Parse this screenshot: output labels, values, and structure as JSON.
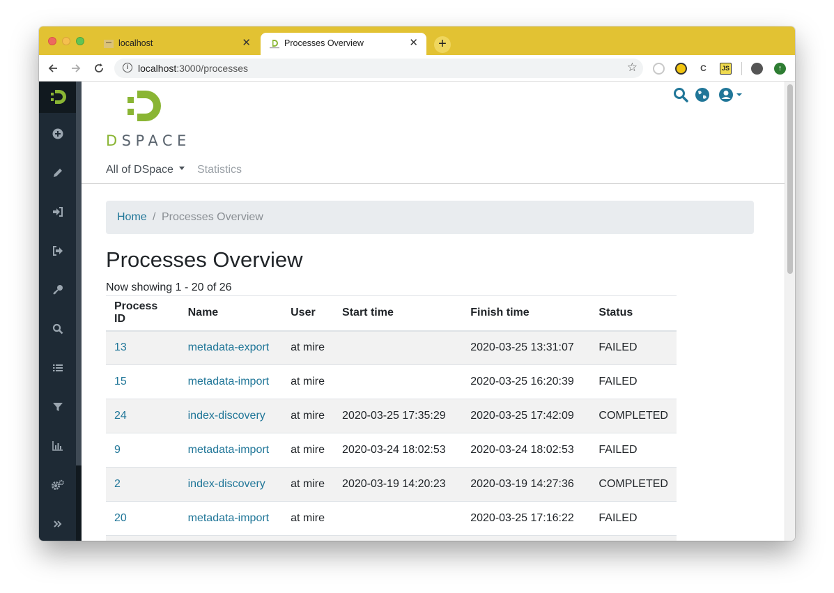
{
  "browser": {
    "tabs": [
      {
        "title": "localhost",
        "close": "✕"
      },
      {
        "title": "Processes Overview",
        "close": "✕"
      }
    ],
    "new_tab": "+",
    "url_host": "localhost",
    "url_rest": ":3000/processes"
  },
  "header": {
    "logo_text": "DSPACE",
    "nav_all": "All of DSpace",
    "nav_stats": "Statistics"
  },
  "breadcrumb": {
    "home": "Home",
    "separator": "/",
    "current": "Processes Overview"
  },
  "page": {
    "title": "Processes Overview",
    "showing": "Now showing 1 - 20 of 26"
  },
  "table": {
    "columns": [
      "Process ID",
      "Name",
      "User",
      "Start time",
      "Finish time",
      "Status"
    ],
    "rows": [
      {
        "id": "13",
        "name": "metadata-export",
        "user": "at mire",
        "start": "",
        "finish": "2020-03-25 13:31:07",
        "status": "FAILED"
      },
      {
        "id": "15",
        "name": "metadata-import",
        "user": "at mire",
        "start": "",
        "finish": "2020-03-25 16:20:39",
        "status": "FAILED"
      },
      {
        "id": "24",
        "name": "index-discovery",
        "user": "at mire",
        "start": "2020-03-25 17:35:29",
        "finish": "2020-03-25 17:42:09",
        "status": "COMPLETED"
      },
      {
        "id": "9",
        "name": "metadata-import",
        "user": "at mire",
        "start": "2020-03-24 18:02:53",
        "finish": "2020-03-24 18:02:53",
        "status": "FAILED"
      },
      {
        "id": "2",
        "name": "index-discovery",
        "user": "at mire",
        "start": "2020-03-19 14:20:23",
        "finish": "2020-03-19 14:27:36",
        "status": "COMPLETED"
      },
      {
        "id": "20",
        "name": "metadata-import",
        "user": "at mire",
        "start": "",
        "finish": "2020-03-25 17:16:22",
        "status": "FAILED"
      }
    ]
  },
  "colors": {
    "tabstrip": "#e2c233",
    "sidebar": "#1e2a35",
    "dspace_green": "#8ab534",
    "link": "#207698"
  },
  "icons": {
    "sidebar": [
      "dspace-logo-icon",
      "plus-circle-icon",
      "pencil-icon",
      "sign-in-icon",
      "sign-out-icon",
      "key-icon",
      "search-icon",
      "list-icon",
      "filter-icon",
      "chart-icon",
      "cogs-icon",
      "chevrons-right-icon"
    ],
    "header": [
      "search-icon",
      "globe-icon",
      "user-circle-icon"
    ]
  }
}
